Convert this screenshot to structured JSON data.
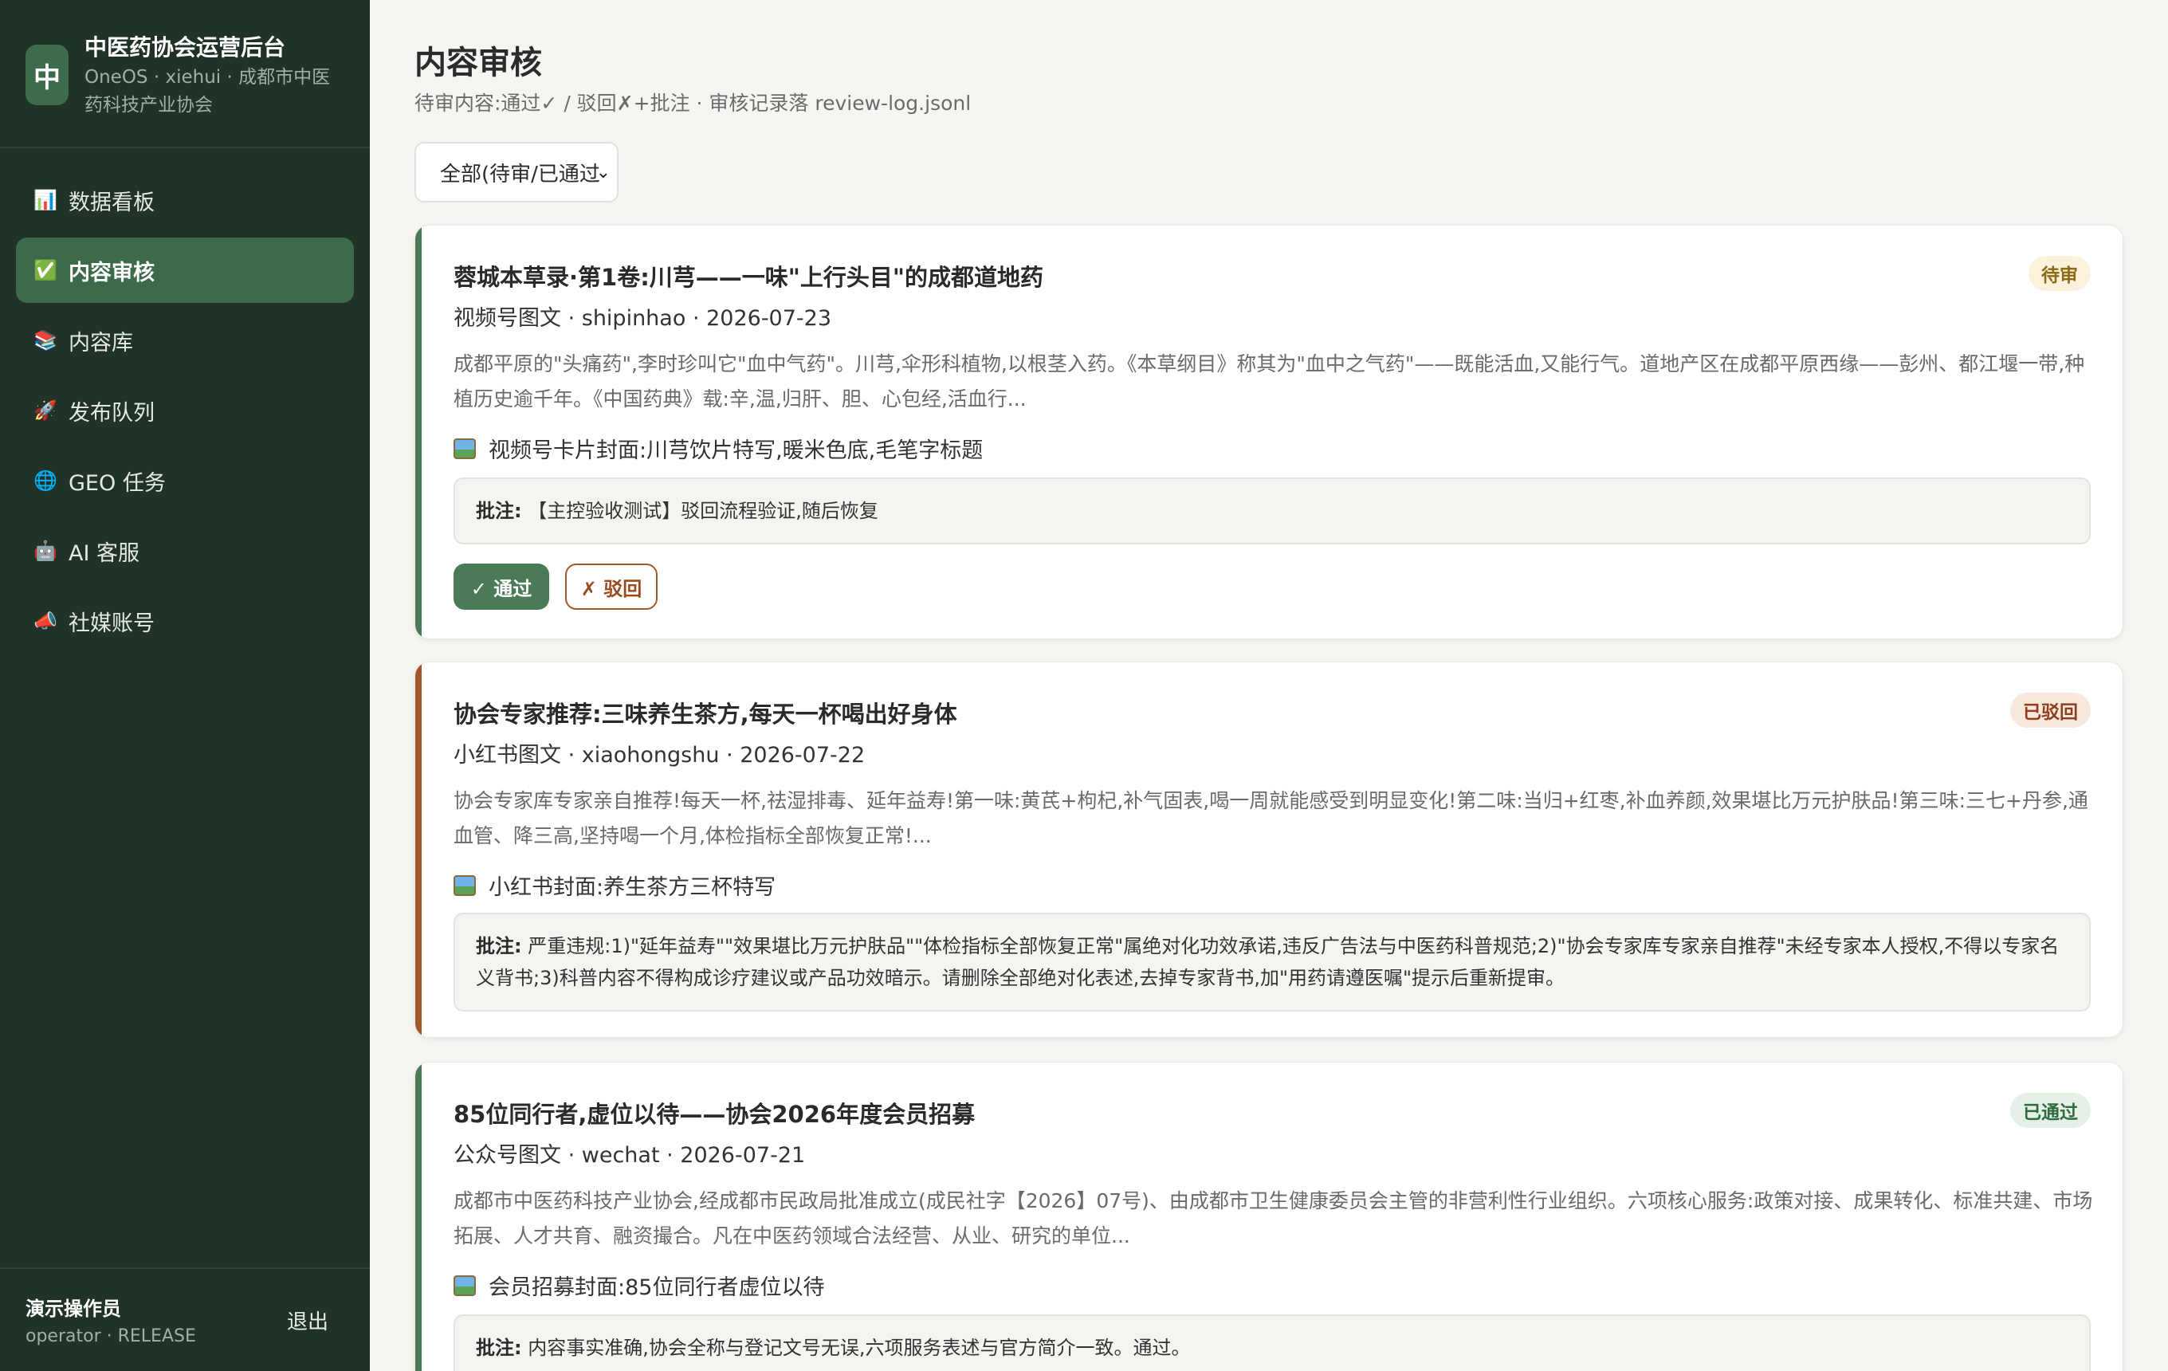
{
  "sidebar": {
    "logo_char": "中",
    "title": "中医药协会运营后台",
    "subtitle": "OneOS · xiehui · 成都市中医药科技产业协会",
    "items": [
      {
        "icon": "📊",
        "label": "数据看板"
      },
      {
        "icon": "✅",
        "label": "内容审核"
      },
      {
        "icon": "📚",
        "label": "内容库"
      },
      {
        "icon": "🚀",
        "label": "发布队列"
      },
      {
        "icon": "🌐",
        "label": "GEO 任务"
      },
      {
        "icon": "🤖",
        "label": "AI 客服"
      },
      {
        "icon": "📣",
        "label": "社媒账号"
      }
    ],
    "operator_name": "演示操作员",
    "operator_role": "operator · RELEASE",
    "logout_label": "退出"
  },
  "header": {
    "title": "内容审核",
    "subtitle": "待审内容:通过✓ / 驳回✗+批注 · 审核记录落 review-log.jsonl"
  },
  "filter": {
    "selected": "全部(待审/已通过"
  },
  "cards": [
    {
      "title": "蓉城本草录·第1卷:川芎——一味\"上行头目\"的成都道地药",
      "meta": "视频号图文 · shipinhao · 2026-07-23",
      "body": "成都平原的\"头痛药\",李时珍叫它\"血中气药\"。川芎,伞形科植物,以根茎入药。《本草纲目》称其为\"血中之气药\"——既能活血,又能行气。道地产区在成都平原西缘——彭州、都江堰一带,种植历史逾千年。《中国药典》载:辛,温,归肝、胆、心包经,活血行...",
      "cover": "视频号卡片封面:川芎饮片特写,暖米色底,毛笔字标题",
      "note_label": "批注:",
      "note": "【主控验收测试】驳回流程验证,随后恢复",
      "status": "待审",
      "approve_label": "✓ 通过",
      "reject_label": "✗ 驳回"
    },
    {
      "title": "协会专家推荐:三味养生茶方,每天一杯喝出好身体",
      "meta": "小红书图文 · xiaohongshu · 2026-07-22",
      "body": "协会专家库专家亲自推荐!每天一杯,祛湿排毒、延年益寿!第一味:黄芪+枸杞,补气固表,喝一周就能感受到明显变化!第二味:当归+红枣,补血养颜,效果堪比万元护肤品!第三味:三七+丹参,通血管、降三高,坚持喝一个月,体检指标全部恢复正常!...",
      "cover": "小红书封面:养生茶方三杯特写",
      "note_label": "批注:",
      "note": "严重违规:1)\"延年益寿\"\"效果堪比万元护肤品\"\"体检指标全部恢复正常\"属绝对化功效承诺,违反广告法与中医药科普规范;2)\"协会专家库专家亲自推荐\"未经专家本人授权,不得以专家名义背书;3)科普内容不得构成诊疗建议或产品功效暗示。请删除全部绝对化表述,去掉专家背书,加\"用药请遵医嘱\"提示后重新提审。",
      "status": "已驳回"
    },
    {
      "title": "85位同行者,虚位以待——协会2026年度会员招募",
      "meta": "公众号图文 · wechat · 2026-07-21",
      "body": "成都市中医药科技产业协会,经成都市民政局批准成立(成民社字【2026】07号)、由成都市卫生健康委员会主管的非营利性行业组织。六项核心服务:政策对接、成果转化、标准共建、市场拓展、人才共育、融资撮合。凡在中医药领域合法经营、从业、研究的单位...",
      "cover": "会员招募封面:85位同行者虚位以待",
      "note_label": "批注:",
      "note": "内容事实准确,协会全称与登记文号无误,六项服务表述与官方简介一致。通过。",
      "status": "已通过"
    }
  ],
  "colors": {
    "sidebar_bg": "#213327",
    "accent": "#3e6a4c",
    "pending_bar": "#4a7a58",
    "rejected_bar": "#a4572a",
    "approved_bar": "#4a7a58"
  }
}
